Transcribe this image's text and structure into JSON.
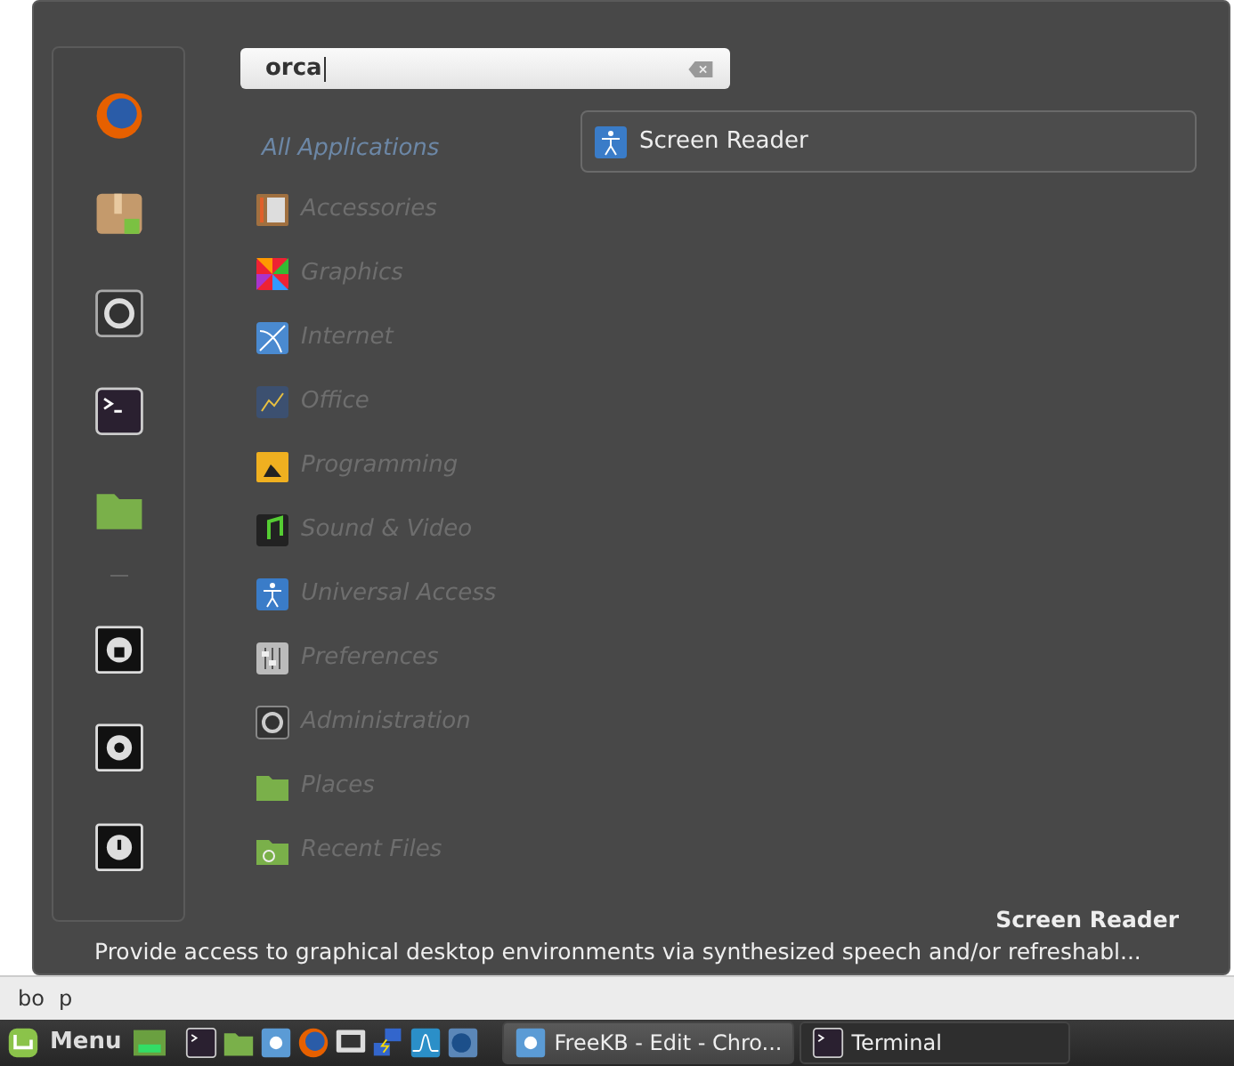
{
  "menu": {
    "search": {
      "value": "orca"
    },
    "categories": [
      {
        "label": "All Applications",
        "selected": true
      },
      {
        "label": "Accessories",
        "selected": false
      },
      {
        "label": "Graphics",
        "selected": false
      },
      {
        "label": "Internet",
        "selected": false
      },
      {
        "label": "Office",
        "selected": false
      },
      {
        "label": "Programming",
        "selected": false
      },
      {
        "label": "Sound & Video",
        "selected": false
      },
      {
        "label": "Universal Access",
        "selected": false
      },
      {
        "label": "Preferences",
        "selected": false
      },
      {
        "label": "Administration",
        "selected": false
      },
      {
        "label": "Places",
        "selected": false
      },
      {
        "label": "Recent Files",
        "selected": false
      }
    ],
    "results": [
      {
        "label": "Screen Reader"
      }
    ],
    "footer": {
      "title": "Screen Reader",
      "description": "Provide access to graphical desktop environments via synthesized speech and/or refreshabl..."
    }
  },
  "status_bar": {
    "path": [
      "bo",
      "p"
    ]
  },
  "taskbar": {
    "menu_label": "Menu",
    "windows": [
      {
        "label": "FreeKB - Edit - Chro...",
        "selected": true
      },
      {
        "label": "Terminal",
        "selected": false
      }
    ]
  }
}
